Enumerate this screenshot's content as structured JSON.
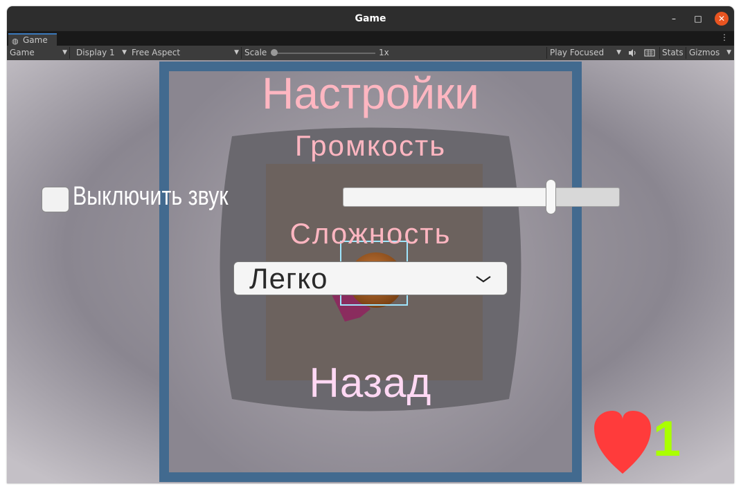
{
  "window": {
    "title": "Game"
  },
  "tab": {
    "label": "Game"
  },
  "toolbar": {
    "mode": "Game",
    "display": "Display 1",
    "aspect": "Free Aspect",
    "scale_label": "Scale",
    "scale_value": "1x",
    "scale_level": 0,
    "play_mode": "Play Focused",
    "stats": "Stats",
    "gizmos": "Gizmos"
  },
  "game_ui": {
    "title": "Настройки",
    "volume_label": "Громкость",
    "mute_toggle_label": "Выключить звук",
    "mute_checked": false,
    "volume_value": 0.75,
    "difficulty_label": "Сложность",
    "difficulty_selected": "Легко",
    "back_label": "Назад",
    "lives": "1"
  },
  "colors": {
    "pink_text": "#ffb6c1",
    "back_text": "#ffd8f4",
    "heart": "#ff3b3b",
    "lives_text": "#aaff00",
    "frame_blue": "#426a8f",
    "titlebar": "#2d2d2d",
    "toolbar": "#3c3c3c",
    "close": "#e95420"
  },
  "icons": [
    "gamepad-icon",
    "minimize-icon",
    "maximize-icon",
    "close-icon",
    "kebab-menu-icon",
    "audio-icon",
    "keyboard-icon",
    "chevron-down-icon",
    "heart-icon"
  ]
}
